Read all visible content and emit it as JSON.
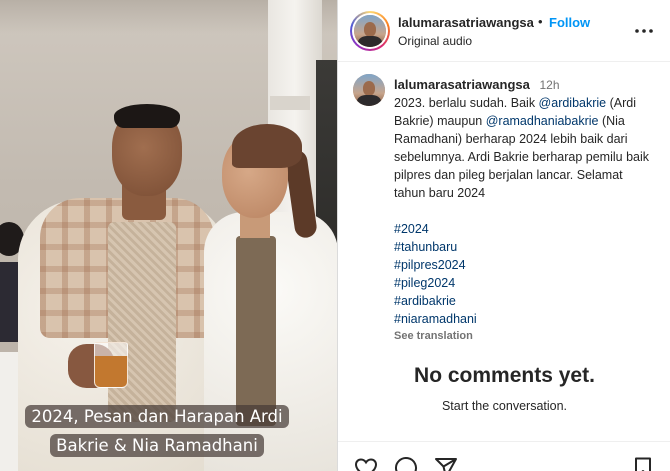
{
  "media": {
    "caption_line1": "2024, Pesan dan Harapan Ardi",
    "caption_line2": "Bakrie & Nia Ramadhani"
  },
  "header": {
    "username": "lalumarasatriawangsa",
    "separator": "•",
    "follow_label": "Follow",
    "audio": "Original audio"
  },
  "post": {
    "username": "lalumarasatriawangsa",
    "time": "12h",
    "text_1": "2023. berlalu sudah. Baik ",
    "mention_1": "@ardibakrie",
    "text_2": " (Ardi Bakrie) maupun ",
    "mention_2": "@ramadhaniabakrie",
    "text_3": " (Nia Ramadhani) berharap 2024 lebih baik dari sebelumnya. Ardi Bakrie berharap pemilu baik pilpres dan pileg berjalan lancar. Selamat tahun baru 2024",
    "hashtags": [
      "#2024",
      "#tahunbaru",
      "#pilpres2024",
      "#pileg2024",
      "#ardibakrie",
      "#niaramadhani"
    ],
    "see_translation": "See translation"
  },
  "comments": {
    "empty_title": "No comments yet.",
    "empty_subtitle": "Start the conversation."
  },
  "icons": {
    "more": "more-options-icon",
    "like": "heart-icon",
    "comment": "comment-icon",
    "share": "share-icon",
    "save": "bookmark-icon"
  },
  "colors": {
    "link": "#00376b",
    "follow": "#0095f6",
    "text": "#262626",
    "muted": "#737373"
  }
}
